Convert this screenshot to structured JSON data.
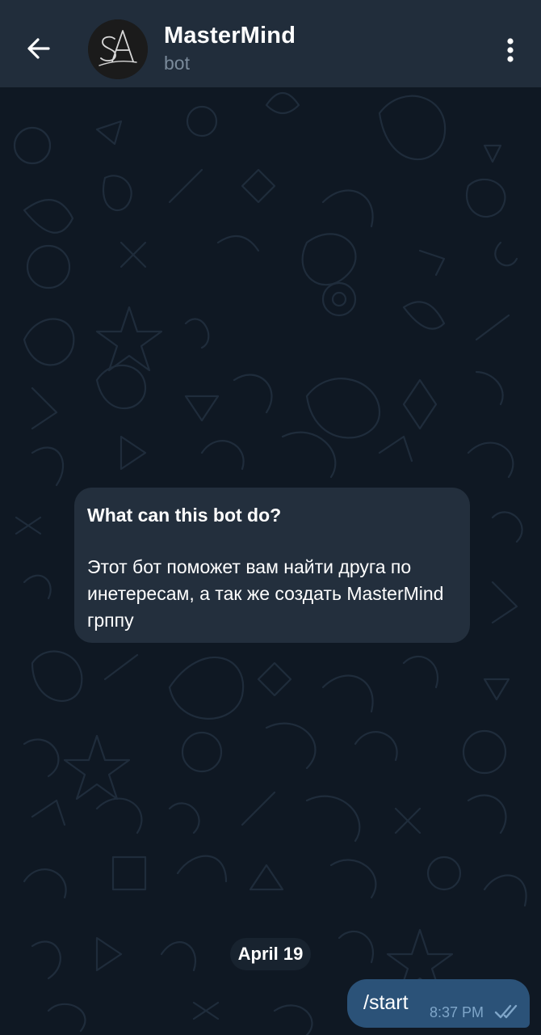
{
  "header": {
    "title": "MasterMind",
    "subtitle": "bot",
    "back_icon": "arrow-left-icon",
    "menu_icon": "more-vertical-icon",
    "avatar_monogram": "SA"
  },
  "info_card": {
    "title": "What can this bot do?",
    "description": "Этот бот поможет вам найти друга по инетересам, а так же создать MasterMind грппу"
  },
  "date_separator": "April 19",
  "messages": [
    {
      "text": "/start",
      "time": "8:37 PM",
      "status_icon": "double-check-icon",
      "outgoing": true
    }
  ],
  "colors": {
    "header_bg": "#212d3b",
    "chat_bg": "#0f1823",
    "card_bg": "#232f3d",
    "outgoing_bubble": "#2b5278",
    "time_text": "#7fa6c9",
    "subtitle_text": "#7a8a9a"
  }
}
